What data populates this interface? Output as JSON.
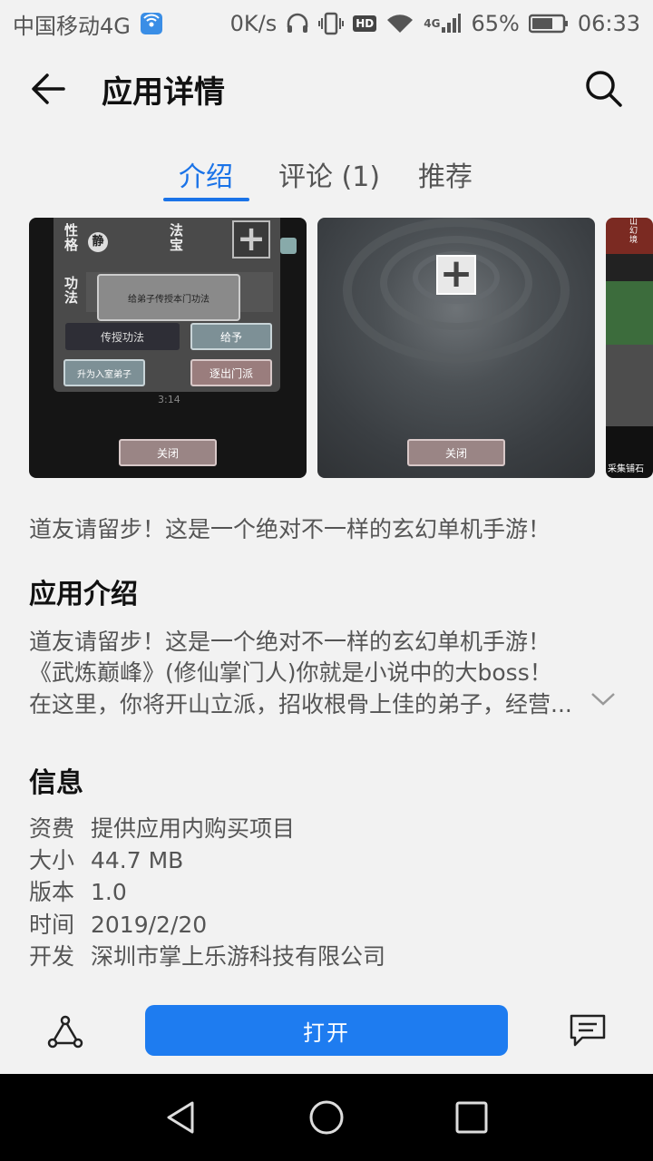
{
  "status_bar": {
    "carrier": "中国移动4G",
    "speed": "0K/s",
    "hd": "HD",
    "network": "4G",
    "battery": "65%",
    "time": "06:33"
  },
  "header": {
    "title": "应用详情"
  },
  "tabs": [
    {
      "label": "介绍"
    },
    {
      "label": "评论 (1)"
    },
    {
      "label": "推荐"
    }
  ],
  "screenshots": {
    "shot1": {
      "label_xingge": "性格",
      "label_fabao": "法宝",
      "label_gongfa": "功法",
      "char_jing": "静",
      "bubble_text": "给弟子传授本门功法",
      "teach_button": "传授功法",
      "give_button": "给予",
      "promote_button": "升为入室弟子",
      "expel_button": "逐出门派",
      "time": "3:14",
      "close_button": "关闭"
    },
    "shot2": {
      "close_button": "关闭"
    },
    "shot3": {
      "label_top": "山幻境",
      "label_bottom": "采集铺石"
    }
  },
  "tagline": "道友请留步！这是一个绝对不一样的玄幻单机手游！",
  "intro": {
    "title": "应用介绍",
    "lines": [
      "道友请留步！这是一个绝对不一样的玄幻单机手游！",
      "《武炼巅峰》(修仙掌门人)你就是小说中的大boss！",
      "在这里，你将开山立派，招收根骨上佳的弟子，经营..."
    ]
  },
  "info": {
    "title": "信息",
    "rows": [
      {
        "key": "资费",
        "value": "提供应用内购买项目"
      },
      {
        "key": "大小",
        "value": "44.7 MB"
      },
      {
        "key": "版本",
        "value": "1.0"
      },
      {
        "key": "时间",
        "value": "2019/2/20"
      },
      {
        "key": "开发",
        "value": "深圳市掌上乐游科技有限公司"
      }
    ]
  },
  "actions": {
    "open_label": "打开"
  },
  "colors": {
    "accent": "#1e7cf0",
    "tab_active": "#1a73e8",
    "background": "#f2f2f2",
    "nav_bar": "#000000"
  }
}
